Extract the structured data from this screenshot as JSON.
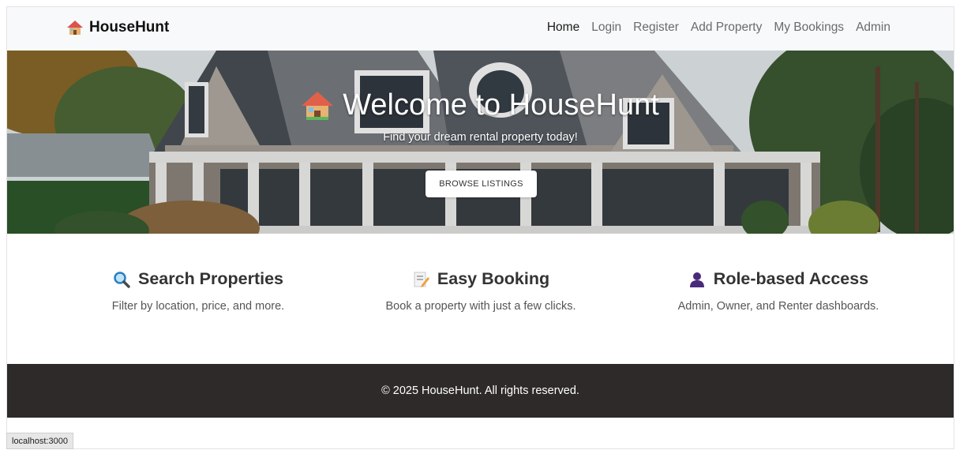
{
  "navbar": {
    "brand": "HouseHunt",
    "links": [
      "Home",
      "Login",
      "Register",
      "Add Property",
      "My Bookings",
      "Admin"
    ],
    "active": "Home"
  },
  "hero": {
    "title": "Welcome to HouseHunt",
    "subtitle": "Find your dream rental property today!",
    "button": "BROWSE LISTINGS"
  },
  "features": [
    {
      "icon": "magnifier-icon",
      "title": "Search Properties",
      "text": "Filter by location, price, and more."
    },
    {
      "icon": "memo-icon",
      "title": "Easy Booking",
      "text": "Book a property with just a few clicks."
    },
    {
      "icon": "user-silhouette-icon",
      "title": "Role-based Access",
      "text": "Admin, Owner, and Renter dashboards."
    }
  ],
  "footer": {
    "text": "© 2025 HouseHunt. All rights reserved."
  },
  "status": {
    "url": "localhost:3000"
  },
  "colors": {
    "footer_bg": "#2d2a29",
    "navbar_bg": "#f8f9fa",
    "button_bg": "#ffffff"
  }
}
